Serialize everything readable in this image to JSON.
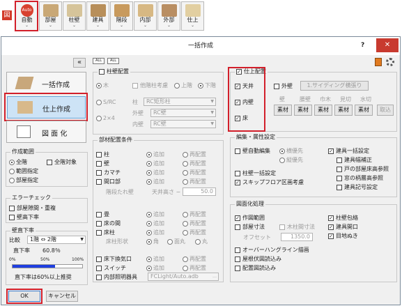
{
  "toolbar": {
    "zu": "図",
    "tools": [
      {
        "label": "自動",
        "badge": "Auto",
        "icon": "auto-icon",
        "color": "#d8412f"
      },
      {
        "label": "部屋",
        "icon": "room-icon",
        "color": "#c9a876"
      },
      {
        "label": "柱壁",
        "icon": "column-wall-icon",
        "color": "#d6c49a"
      },
      {
        "label": "建具",
        "icon": "fitting-icon",
        "color": "#b88f5a"
      },
      {
        "label": "階段",
        "icon": "stairs-icon",
        "color": "#c89a5d"
      },
      {
        "label": "内部",
        "icon": "interior-icon",
        "color": "#d7b883"
      },
      {
        "label": "外部",
        "icon": "exterior-icon",
        "color": "#b98e62"
      },
      {
        "label": "仕上",
        "icon": "finish-icon",
        "color": "#e2cfa1"
      }
    ]
  },
  "dialog": {
    "title": "一括作成",
    "help": "?",
    "close": "✕",
    "collapse": "«"
  },
  "modes": {
    "batch": "一括作成",
    "finish": "仕上作成",
    "drawing": "図 面 化"
  },
  "range": {
    "title": "作成範囲",
    "all_floors": "全階",
    "all_target": "全階対象",
    "range_spec": "範囲指定",
    "room_spec": "部屋指定"
  },
  "errors": {
    "title": "エラーチェック",
    "gap": "部屋隙間・重複",
    "wall_height": "壁高下率"
  },
  "ratio": {
    "title": "壁直下率",
    "compare": "比較",
    "floors": "1階 ⇔ 2階",
    "direct_label": "直下率",
    "direct_value": "60.8％",
    "t0": "0%",
    "t50": "50%",
    "t100": "100%",
    "progress": 0.608,
    "note": "直下率は60%以上推奨"
  },
  "ok": "OK",
  "cancel": "キャンセル",
  "all": "ALL",
  "column": {
    "title": "柱壁配置",
    "wood": "木",
    "other_floor": "他階柱考慮",
    "upper": "上階",
    "lower": "下階",
    "src": "S/RC",
    "pillar": "柱",
    "pillar_val": "RC矩形柱",
    "two_by_four": "2×4",
    "outer": "外壁",
    "outer_val": "RC壁",
    "inner": "内壁",
    "inner_val": "RC壁"
  },
  "members": {
    "title": "部材配置条件",
    "rows": [
      {
        "label": "柱",
        "add": "追加",
        "re": "再配置"
      },
      {
        "label": "壁",
        "add": "追加",
        "re": "再配置"
      },
      {
        "label": "カマチ",
        "add": "追加",
        "re": "再配置"
      },
      {
        "label": "間口部",
        "add": "追加",
        "re": "再配置"
      }
    ],
    "hanging": "階段たれ壁",
    "ceiling": "天井高さ −",
    "ceiling_val": "50.0",
    "rows2": [
      {
        "label": "畳",
        "add": "追加",
        "re": "再配置"
      },
      {
        "label": "床の間",
        "add": "追加",
        "re": "再配置"
      },
      {
        "label": "床柱",
        "add": "追加",
        "re": "再配置"
      }
    ],
    "pillar_shape": "床柱形状",
    "square": "角",
    "chamfer": "面丸",
    "round": "丸",
    "rows3": [
      {
        "label": "床下換気口",
        "add": "追加",
        "re": "再配置"
      },
      {
        "label": "スイッチ",
        "add": "追加",
        "re": "再配置"
      }
    ],
    "lighting": "内部照明器具",
    "lighting_val": "FCLight/Auto.adb"
  },
  "finish": {
    "title": "仕上配置",
    "ceiling": "天井",
    "inner": "内壁",
    "floor": "床",
    "outer_wall": "外壁",
    "siding": "1.サイディング横張り",
    "cols": [
      "壁",
      "腰壁",
      "巾木",
      "見切",
      "水切"
    ],
    "material": "素材",
    "remove": "取込"
  },
  "edit": {
    "title": "編集・属性設定",
    "auto_wall": "壁自動編集",
    "horizontal": "横優先",
    "vertical": "縦優先",
    "batch_fitting": "建具一括設定",
    "fitting_width": "建具幅補正",
    "door_floor": "戸の部屋床高参照",
    "window_room": "窓の柄層高参照",
    "fitting_mark": "建具記号設定",
    "column_wall_batch": "柱壁一括設定",
    "skip_floor": "スキップフロア区画考慮"
  },
  "drawing": {
    "title": "図面化処理",
    "range": "作図範囲",
    "pillar_wrap": "柱壁包絡",
    "room_size": "部屋寸法",
    "wood_size": "木柱間寸法",
    "fitting_open": "建具開口",
    "offset": "オフセット",
    "offset_val": "1350.0",
    "eyes": "目地ぬき",
    "overhang": "オーバーハングライン描画",
    "roof": "屋根伏図読込み",
    "layout": "配置図読込み"
  },
  "accent": "#d21f2a"
}
